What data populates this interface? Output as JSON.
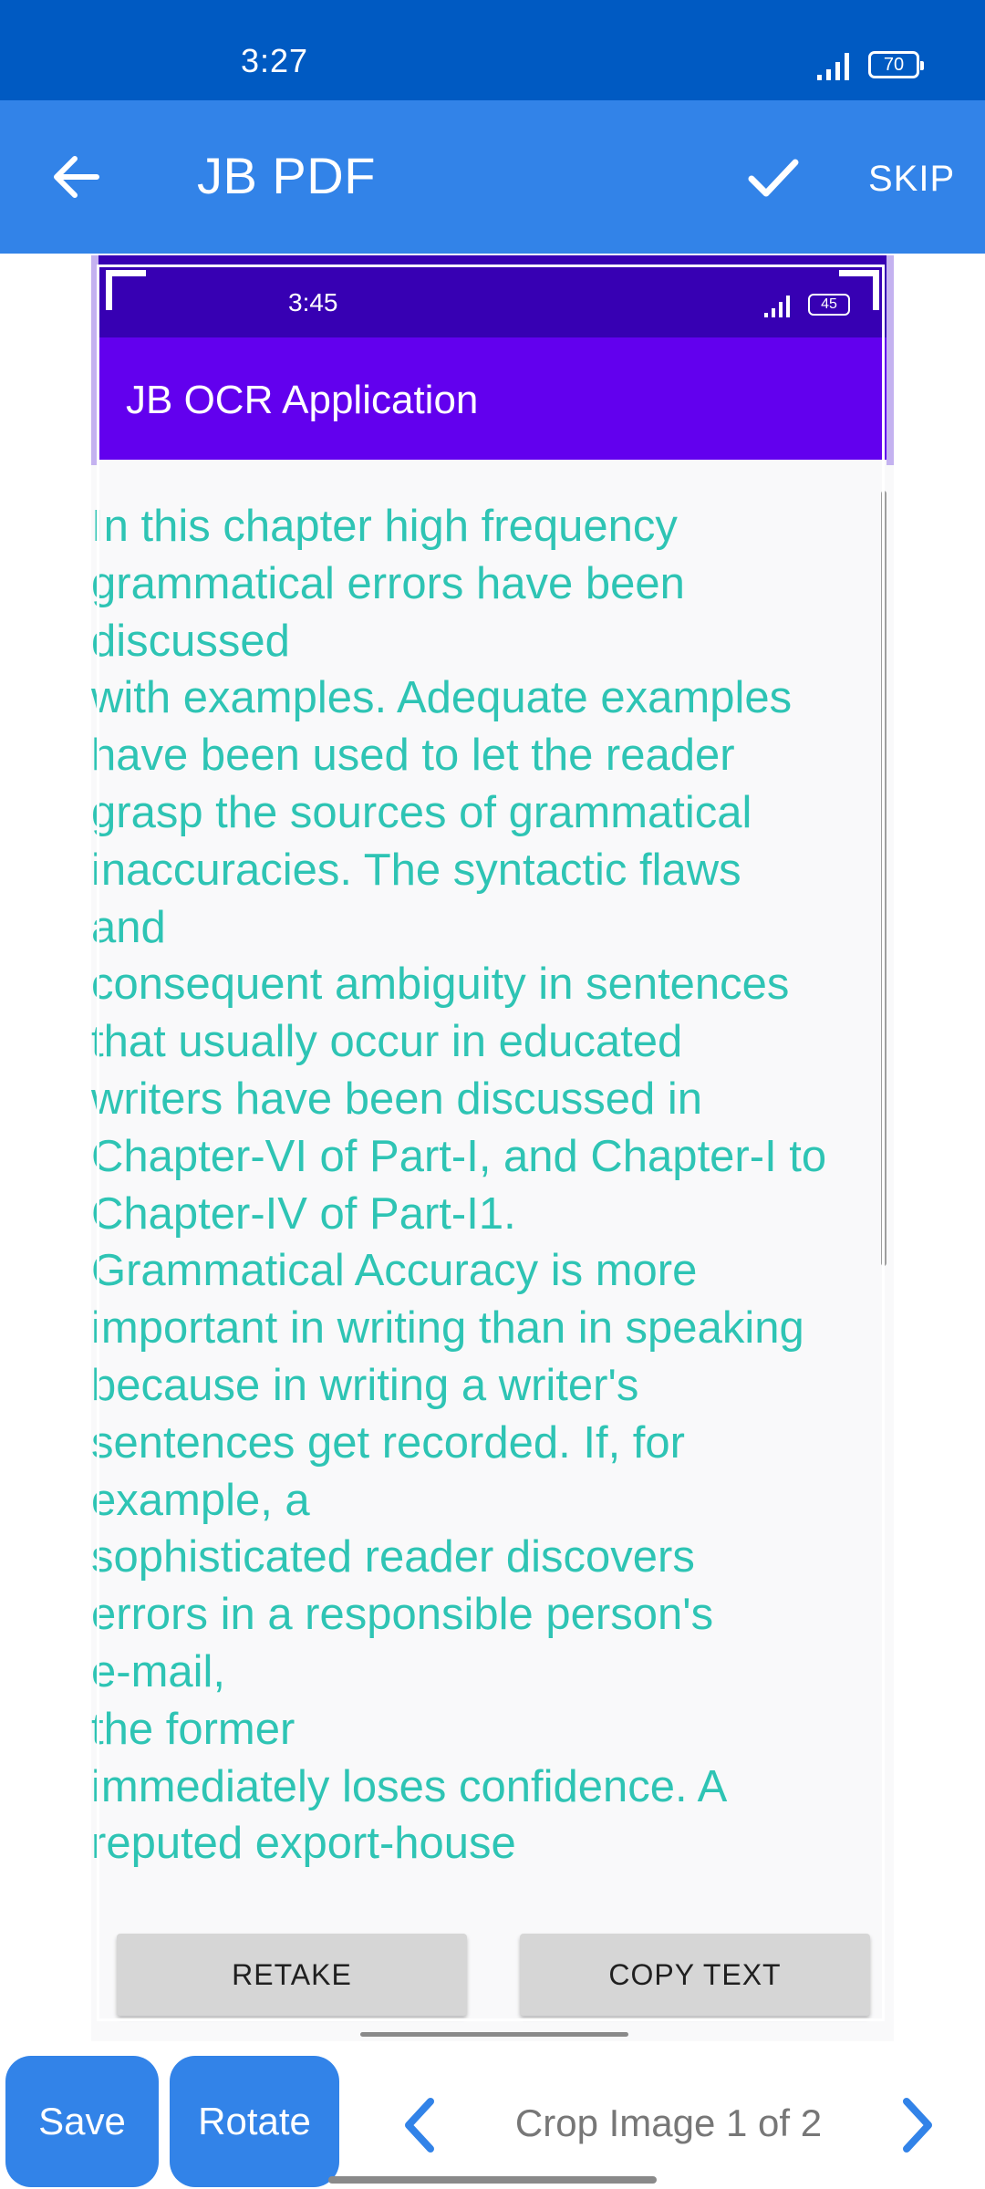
{
  "status_bar": {
    "time": "3:27",
    "battery": "70"
  },
  "app_bar": {
    "title": "JB PDF",
    "skip_label": "SKIP"
  },
  "screenshot": {
    "status_time": "3:45",
    "status_battery": "45",
    "app_title": "JB OCR Application",
    "ocr_lines": [
      "In this chapter high frequency",
      "grammatical errors have been",
      "discussed",
      "with examples. Adequate examples",
      "have been used to let the reader",
      "grasp the sources of grammatical",
      "inaccuracies. The syntactic flaws",
      "and",
      "consequent ambiguity in sentences",
      "that usually occur in educated",
      "writers have been discussed in",
      "Chapter-VI of Part-I, and Chapter-I to",
      "Chapter-IV of Part-I1.",
      "Grammatical Accuracy is more",
      "important in writing than in speaking",
      "because in writing a writer's",
      "sentences get recorded. If, for",
      "example, a",
      "sophisticated reader discovers",
      "errors in a responsible person's",
      "e-mail,",
      "the former",
      "immediately loses confidence. A",
      "reputed export-house"
    ],
    "retake_label": "RETAKE",
    "copy_label": "COPY TEXT"
  },
  "bottom_bar": {
    "save_label": "Save",
    "rotate_label": "Rotate",
    "page_label": "Crop Image 1 of 2"
  },
  "colors": {
    "status_bar": "#005ac2",
    "app_bar": "#3283e8",
    "inner_status": "#3700b3",
    "inner_toolbar": "#6200ee",
    "ocr_text": "#2ec4b4"
  },
  "icons": {
    "back": "arrow-left-icon",
    "confirm": "check-icon",
    "prev": "chevron-left-icon",
    "next": "chevron-right-icon"
  }
}
